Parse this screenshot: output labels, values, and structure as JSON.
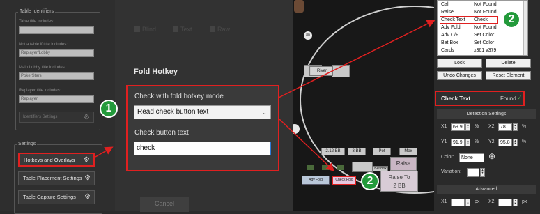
{
  "left_panel": {
    "identifiers_title": "Table Identifiers",
    "fields": [
      {
        "label": "Table title includes:",
        "value": ""
      },
      {
        "label": "Not a table if title includes:",
        "value": "Replayer/Lobby"
      },
      {
        "label": "Main Lobby title includes:",
        "value": "PokerStars"
      },
      {
        "label": "Replayer title includes:",
        "value": "Replayer"
      }
    ],
    "identifiers_settings": "Identifiers Settings",
    "settings_title": "Settings",
    "buttons": [
      "Hotkeys and Overlays",
      "Table Placement Settings",
      "Table Capture Settings"
    ]
  },
  "dialog": {
    "checkboxes": [
      "Blind",
      "Text",
      "Raw"
    ],
    "title": "Fold Hotkey",
    "mode_label": "Check with fold hotkey mode",
    "mode_value": "Read check button text",
    "button_text_label": "Check button text",
    "button_text_value": "check",
    "cancel": "Cancel"
  },
  "table": {
    "board_label": "River",
    "bet_buttons": [
      "2.12 BB",
      "3 BB",
      "Pot",
      "Max"
    ],
    "action_small": [
      "Adv Fold",
      "Check Fold"
    ],
    "bet_box": "Bet Box",
    "raise": "Raise",
    "raise_to": "Raise To",
    "raise_to_amount": "2 BB",
    "seat_label": "80"
  },
  "right_panel": {
    "rows": [
      {
        "name": "Call",
        "value": "Not Found"
      },
      {
        "name": "Raise",
        "value": "Not Found"
      },
      {
        "name": "Check Text",
        "value": "Check"
      },
      {
        "name": "Adv Fold",
        "value": "Not Found"
      },
      {
        "name": "Adv C/F",
        "value": "Set Color"
      },
      {
        "name": "Bet Box",
        "value": "Set Color"
      },
      {
        "name": "Cards",
        "value": "x361 v379"
      }
    ],
    "lock": "Lock",
    "delete": "Delete",
    "undo": "Undo Changes",
    "reset": "Reset Element",
    "element_name": "Check Text",
    "element_status": "Found",
    "detection_title": "Detection Settings",
    "x1_label": "X1",
    "x1": "69.9",
    "x2_label": "X2",
    "x2": "78",
    "y1_label": "Y1",
    "y1": "91.9",
    "y2_label": "Y2",
    "y2": "95.8",
    "pct": "%",
    "color_label": "Color:",
    "color_value": "None",
    "variation_label": "Variation:",
    "advanced_title": "Advanced",
    "px": "px"
  },
  "annotations": {
    "badge1": "1",
    "badge2": "2"
  },
  "colors": {
    "highlight": "#e02020",
    "badge": "#239a3b",
    "focus": "#2f7bd6"
  }
}
